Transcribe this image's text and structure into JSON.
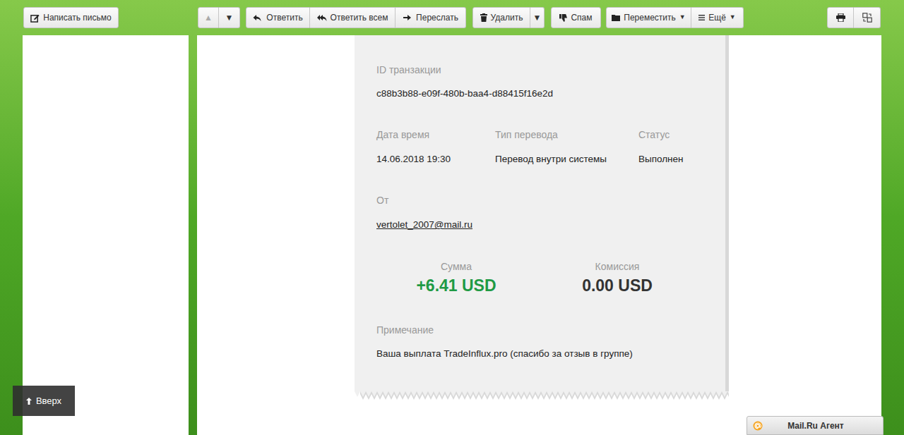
{
  "toolbar": {
    "compose": {
      "label": "Написать письмо"
    },
    "nav": [
      {
        "label": "▲",
        "disabled": true
      },
      {
        "label": "▼",
        "disabled": false
      }
    ],
    "actions": [
      {
        "label": "Ответить"
      },
      {
        "label": "Ответить всем"
      },
      {
        "label": "Переслать"
      }
    ],
    "delete": {
      "label": "Удалить",
      "caret": "▼"
    },
    "spam": {
      "label": "Спам"
    },
    "move": {
      "label": "Переместить",
      "caret": "▼"
    },
    "more": {
      "label": "Ещё",
      "caret": "▼"
    }
  },
  "receipt": {
    "id_label": "ID транзакции",
    "id": "c88b3b88-e09f-480b-baa4-d88415f16e2d",
    "fields": [
      {
        "label": "Дата время",
        "value": "14.06.2018 19:30"
      },
      {
        "label": "Тип перевода",
        "value": "Перевод внутри системы"
      },
      {
        "label": "Статус",
        "value": "Выполнен"
      }
    ],
    "from_label": "От",
    "from": "vertolet_2007@mail.ru",
    "amounts": [
      {
        "label": "Сумма",
        "value": "+6.41 USD",
        "color": "#1f9a45"
      },
      {
        "label": "Комиссия",
        "value": "0.00 USD",
        "color": "#333333"
      }
    ],
    "note_label": "Примечание",
    "note": "Ваша выплата TradeInflux.pro (спасибо за отзыв в группе)"
  },
  "scroll_top": {
    "label": "Вверх"
  },
  "agent": {
    "label": "Mail.Ru Агент"
  }
}
